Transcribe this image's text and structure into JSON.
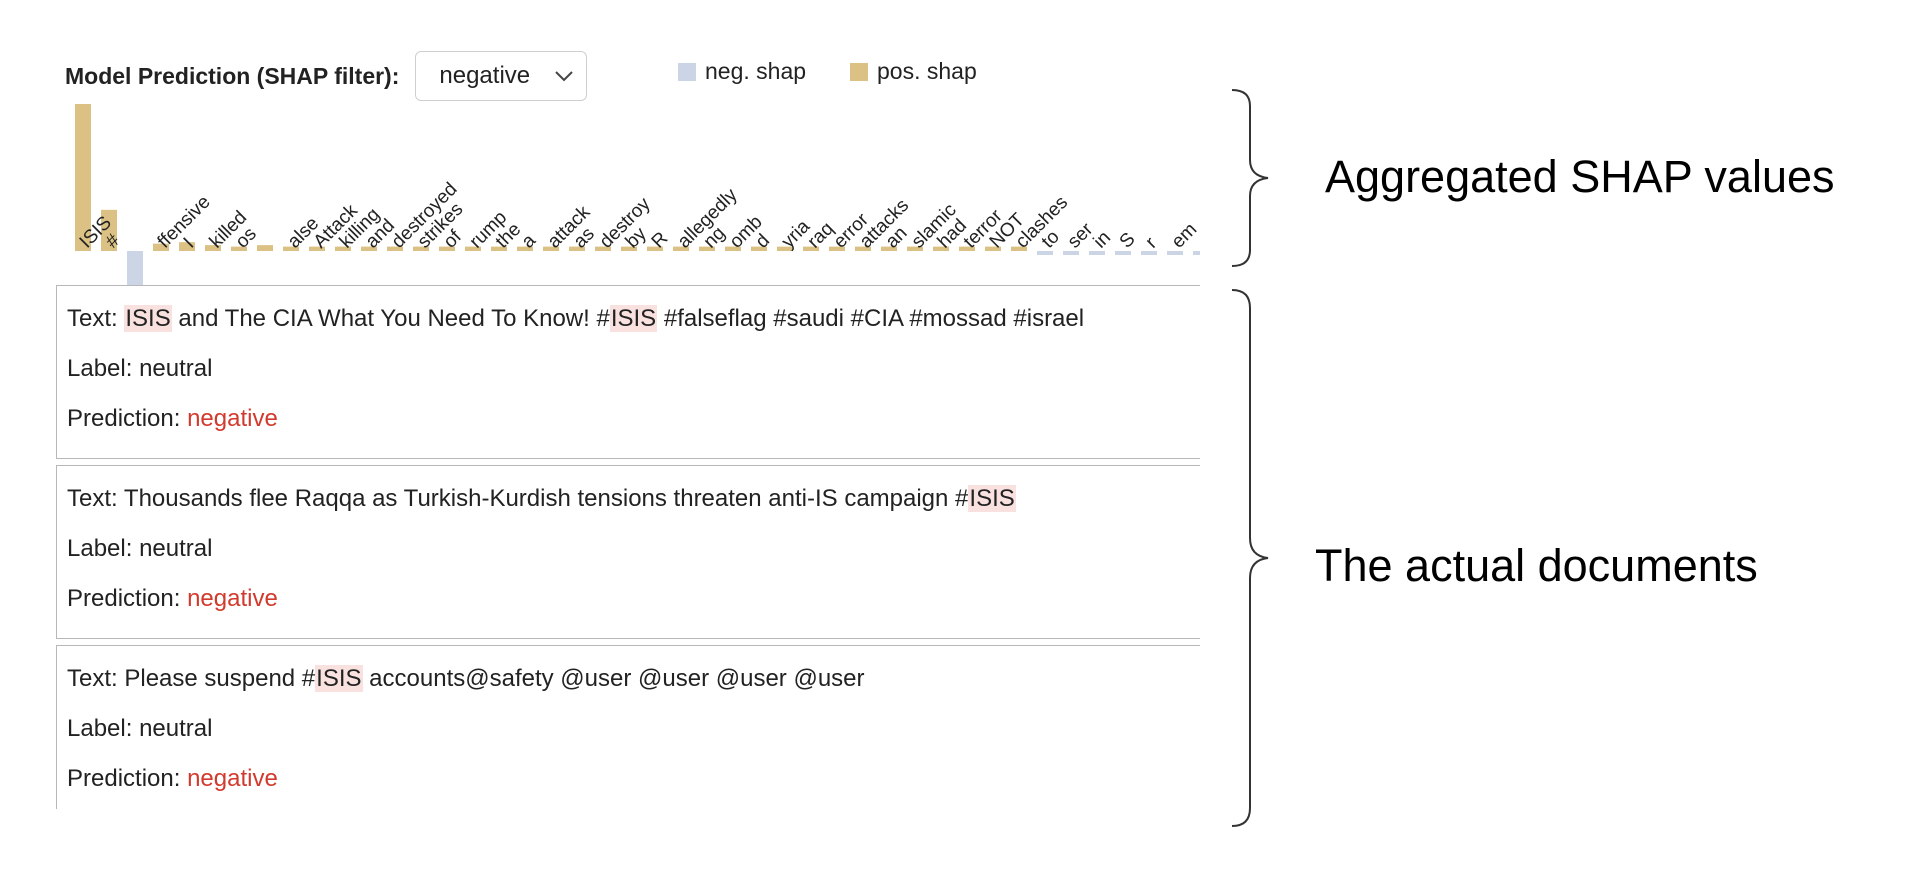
{
  "header": {
    "label": "Model Prediction (SHAP filter):",
    "filter_value": "negative"
  },
  "legend": {
    "neg_label": "neg. shap",
    "pos_label": "pos. shap",
    "neg_color": "#cbd5e6",
    "pos_color": "#dcc184"
  },
  "chart_data": {
    "type": "bar",
    "title": "",
    "categories": [
      "ISIS",
      "#",
      "",
      "ffensive",
      "I",
      "killed",
      "os",
      "",
      "alse",
      "Attack",
      "killing",
      "and",
      "destroyed",
      "strikes",
      "of",
      "rump",
      "the",
      "a",
      "attack",
      "as",
      "destroy",
      "by",
      "R",
      "allegedly",
      "ng",
      "omb",
      "d",
      "yria",
      "raq",
      "error",
      "attacks",
      "an",
      "slamic",
      "had",
      "terror",
      "NOT",
      "clashes",
      "to",
      "ser",
      "in",
      "S",
      "r",
      "em",
      "."
    ],
    "values": [
      1.0,
      0.28,
      -0.24,
      0.05,
      0.06,
      0.04,
      0.03,
      0.04,
      0.03,
      0.03,
      0.03,
      0.03,
      0.03,
      0.03,
      0.03,
      0.03,
      0.03,
      0.03,
      0.03,
      0.03,
      0.03,
      0.03,
      0.03,
      0.03,
      0.03,
      0.03,
      0.03,
      0.03,
      0.03,
      0.03,
      0.03,
      0.03,
      0.03,
      0.03,
      0.03,
      0.03,
      0.03,
      -0.02,
      -0.02,
      -0.02,
      -0.02,
      -0.02,
      -0.02,
      -0.02
    ],
    "value_range": [
      -0.3,
      1.0
    ]
  },
  "annotations": {
    "top": "Aggregated SHAP values",
    "bottom": "The actual documents"
  },
  "documents": [
    {
      "segments": [
        {
          "t": "Text: ",
          "hl": false
        },
        {
          "t": "ISIS",
          "hl": true
        },
        {
          "t": " and The CIA What You Need To Know! #",
          "hl": false
        },
        {
          "t": "ISIS",
          "hl": true
        },
        {
          "t": " #falseflag #saudi #CIA #mossad #israel",
          "hl": false
        }
      ],
      "label_prefix": "Label: ",
      "label": "neutral",
      "prediction_prefix": "Prediction: ",
      "prediction": "negative"
    },
    {
      "segments": [
        {
          "t": "Text: Thousands flee Raqqa as Turkish-Kurdish tensions threaten anti-IS campaign #",
          "hl": false
        },
        {
          "t": "ISIS",
          "hl": true
        }
      ],
      "label_prefix": "Label: ",
      "label": "neutral",
      "prediction_prefix": "Prediction: ",
      "prediction": "negative"
    },
    {
      "segments": [
        {
          "t": "Text: Please suspend #",
          "hl": false
        },
        {
          "t": "ISIS",
          "hl": true
        },
        {
          "t": " accounts@safety @user @user @user @user",
          "hl": false
        }
      ],
      "label_prefix": "Label: ",
      "label": "neutral",
      "prediction_prefix": "Prediction: ",
      "prediction": "negative"
    }
  ]
}
